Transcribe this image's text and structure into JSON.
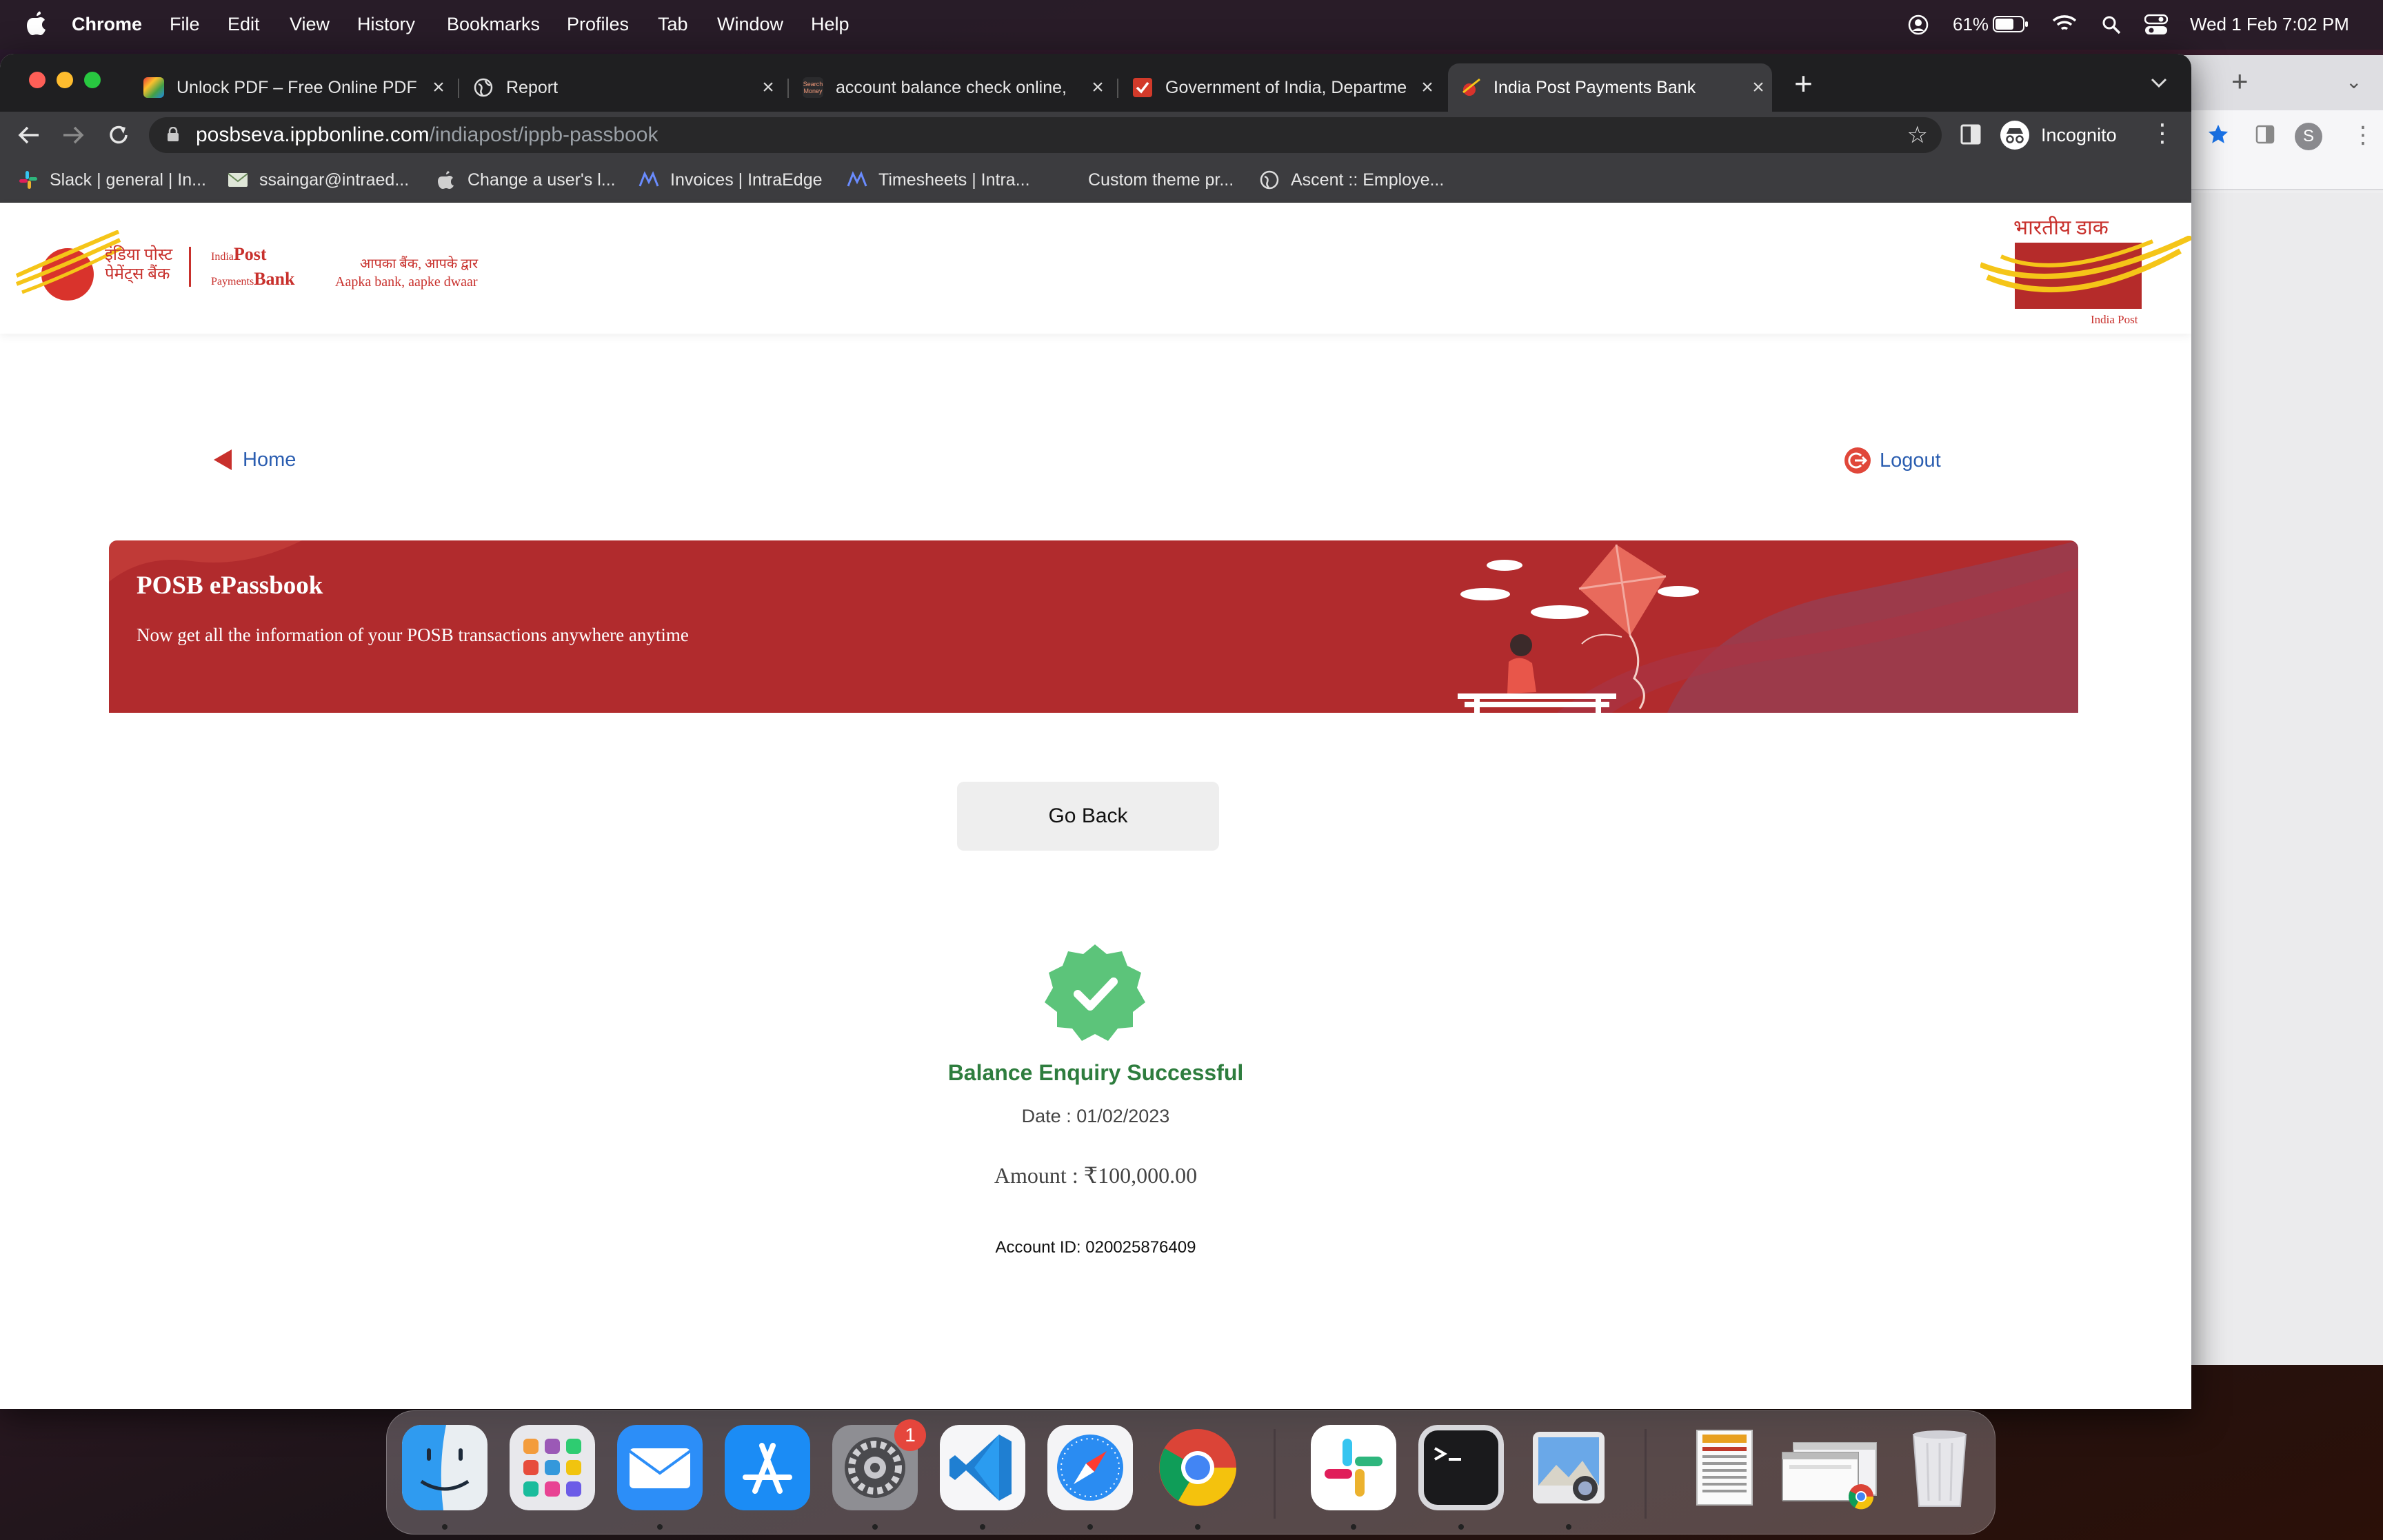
{
  "menubar": {
    "app_name": "Chrome",
    "menus": [
      "File",
      "Edit",
      "View",
      "History",
      "Bookmarks",
      "Profiles",
      "Tab",
      "Window",
      "Help"
    ],
    "battery": "61%",
    "datetime": "Wed 1 Feb  7:02 PM"
  },
  "tabs": [
    {
      "title": "Unlock PDF – Free Online PDF",
      "icon": "ilovepdf-icon"
    },
    {
      "title": "Report",
      "icon": "globe-icon"
    },
    {
      "title": "account balance check online,",
      "icon": "search-icon"
    },
    {
      "title": "Government of India, Departme",
      "icon": "gov-icon"
    },
    {
      "title": "India Post Payments Bank",
      "icon": "ippb-icon",
      "active": true
    }
  ],
  "address_bar": {
    "host": "posbseva.ippbonline.com",
    "path": "/indiapost/ippb-passbook",
    "profile_label": "Incognito"
  },
  "bookmarks": [
    {
      "label": "Slack | general | In...",
      "icon": "slack-icon"
    },
    {
      "label": "ssaingar@intraed...",
      "icon": "mail-icon"
    },
    {
      "label": "Change a user's l...",
      "icon": "apple-icon"
    },
    {
      "label": "Invoices | IntraEdge",
      "icon": "intraedge-icon"
    },
    {
      "label": "Timesheets | Intra...",
      "icon": "intraedge-icon"
    },
    {
      "label": "Custom theme pr...",
      "icon": "blank-icon"
    },
    {
      "label": "Ascent :: Employe...",
      "icon": "globe-icon"
    }
  ],
  "header": {
    "logo_hindi": "इंडिया पोस्ट पेमेंट्स बैंक",
    "logo_en_small": "India",
    "logo_en_post": "Post",
    "logo_en_payments": "Payments",
    "logo_en_bank": "Bank",
    "tagline_hindi": "आपका बैंक, आपके द्वार",
    "tagline_en": "Aapka bank, aapke dwaar",
    "right_logo_hindi": "भारतीय डाक",
    "right_logo_en": "India Post"
  },
  "nav": {
    "home_label": "Home",
    "logout_label": "Logout"
  },
  "banner": {
    "title": "POSB ePassbook",
    "subtitle": "Now get all the information of your POSB transactions anywhere anytime"
  },
  "actions": {
    "go_back_label": "Go Back"
  },
  "result": {
    "status": "Balance Enquiry Successful",
    "date": "Date : 01/02/2023",
    "amount": "Amount : ₹100,000.00",
    "account": "Account ID: 020025876409"
  },
  "dock": {
    "apps": [
      "Finder",
      "Launchpad",
      "Mail",
      "App Store",
      "System Settings",
      "Visual Studio Code",
      "Safari",
      "Google Chrome",
      "Slack",
      "Terminal",
      "Preview"
    ],
    "settings_badge": "1"
  },
  "colors": {
    "brand_red": "#b12b2d",
    "success_green": "#5cc47a",
    "link_blue": "#2a5db0"
  }
}
